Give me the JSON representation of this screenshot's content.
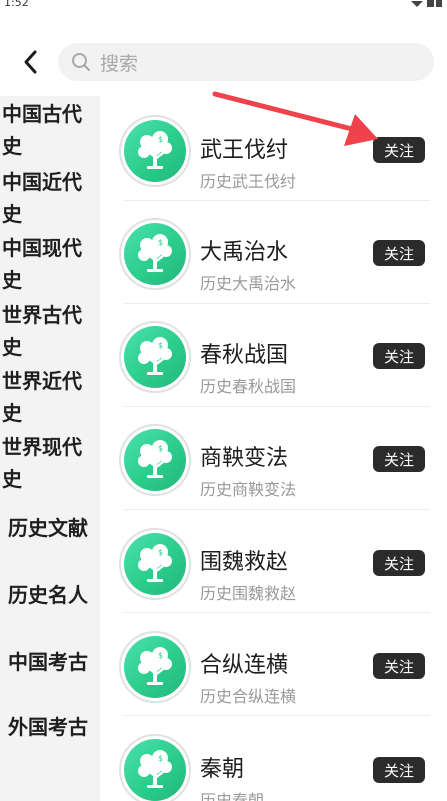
{
  "status_bar": {
    "time": "1:52"
  },
  "header": {
    "back_icon": "chevron-left-icon",
    "search": {
      "icon": "search-icon",
      "placeholder": "搜索"
    }
  },
  "sidebar": {
    "items": [
      {
        "label": "中国古代史"
      },
      {
        "label": "中国近代史"
      },
      {
        "label": "中国现代史"
      },
      {
        "label": "世界古代史"
      },
      {
        "label": "世界近代史"
      },
      {
        "label": "世界现代史"
      },
      {
        "label": "历史文献"
      },
      {
        "label": "历史名人"
      },
      {
        "label": "中国考古"
      },
      {
        "label": "外国考古"
      }
    ]
  },
  "list": {
    "items": [
      {
        "title": "武王伐纣",
        "subtitle": "历史武王伐纣",
        "follow_label": "关注"
      },
      {
        "title": "大禹治水",
        "subtitle": "历史大禹治水",
        "follow_label": "关注"
      },
      {
        "title": "春秋战国",
        "subtitle": "历史春秋战国",
        "follow_label": "关注"
      },
      {
        "title": "商鞅变法",
        "subtitle": "历史商鞅变法",
        "follow_label": "关注"
      },
      {
        "title": "围魏救赵",
        "subtitle": "历史围魏救赵",
        "follow_label": "关注"
      },
      {
        "title": "合纵连横",
        "subtitle": "历史合纵连横",
        "follow_label": "关注"
      },
      {
        "title": "秦朝",
        "subtitle": "历史秦朝",
        "follow_label": "关注"
      }
    ]
  },
  "colors": {
    "accent_green": "#2ecf8e",
    "follow_button": "#2b2b2b",
    "annotation_arrow": "#f0424b"
  }
}
